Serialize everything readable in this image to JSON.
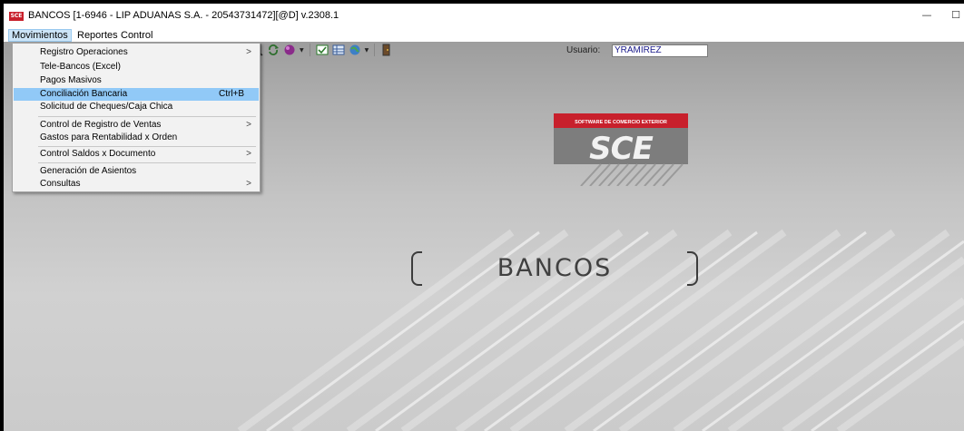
{
  "window": {
    "icon_text": "SCE",
    "title": "BANCOS [1-6946 - LIP ADUANAS S.A. - 20543731472][@D] v.2308.1",
    "minimize_glyph": "—",
    "maximize_glyph": "☐"
  },
  "menubar": {
    "items": [
      {
        "label": "Movimientos"
      },
      {
        "label": "Reportes"
      },
      {
        "label": "Control"
      }
    ]
  },
  "dropdown": {
    "submenu_arrow": ">",
    "items": [
      {
        "label": "Registro Operaciones",
        "shortcut": "",
        "has_submenu": true
      },
      {
        "label": "Tele-Bancos (Excel)",
        "shortcut": "",
        "has_submenu": false
      },
      {
        "label": "Pagos Masivos",
        "shortcut": "",
        "has_submenu": false
      },
      {
        "label": "Conciliación Bancaria",
        "shortcut": "Ctrl+B",
        "has_submenu": false,
        "selected": true
      },
      {
        "label": "Solicitud de Cheques/Caja Chica",
        "shortcut": "",
        "has_submenu": false
      },
      {
        "label": "Control de Registro de Ventas",
        "shortcut": "",
        "has_submenu": true
      },
      {
        "label": "Gastos para Rentabilidad x Orden",
        "shortcut": "",
        "has_submenu": false
      },
      {
        "label": "Control Saldos x Documento",
        "shortcut": "",
        "has_submenu": true
      },
      {
        "label": "Generación de Asientos",
        "shortcut": "",
        "has_submenu": false
      },
      {
        "label": "Consultas",
        "shortcut": "",
        "has_submenu": true
      }
    ]
  },
  "toolbar": {
    "dropdown_glyph": "▼",
    "icons": [
      "preview-icon",
      "refresh-icon",
      "color-icon",
      "check-list-icon",
      "grid-icon",
      "globe-icon",
      "exit-door-icon"
    ]
  },
  "user": {
    "label": "Usuario:",
    "value": "YRAMIREZ"
  },
  "logo": {
    "tagline": "SOFTWARE DE COMERCIO EXTERIOR",
    "text": "SCE",
    "colors": {
      "red": "#c8202c",
      "gray": "#8a8a8a"
    }
  },
  "center": {
    "title": "BANCOS"
  },
  "colors": {
    "menu_highlight": "#91c9f7",
    "menu_bg": "#f2f2f2"
  }
}
